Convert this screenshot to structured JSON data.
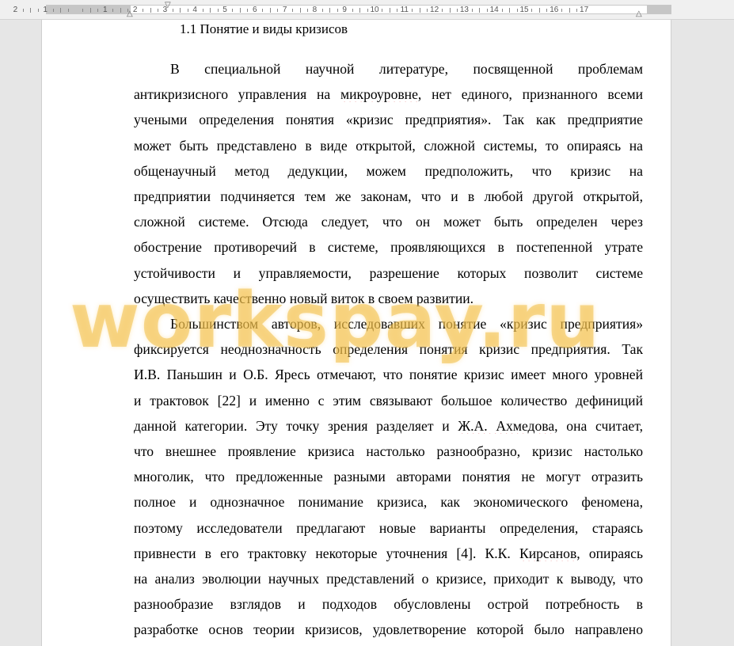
{
  "ruler": {
    "numbers": [
      "2",
      "1",
      "1",
      "2",
      "3",
      "4",
      "5",
      "6",
      "7",
      "8",
      "9",
      "10",
      "11",
      "12",
      "13",
      "14",
      "15",
      "16",
      "17"
    ]
  },
  "document": {
    "heading": "1.1 Понятие и виды кризисов",
    "lines": [
      {
        "text": "В специальной научной литературе, посвященной проблемам",
        "indent": true
      },
      {
        "parts": [
          {
            "t": "антикризисного управления на "
          },
          {
            "t": "микроуровне",
            "spell": true
          },
          {
            "t": ", нет единого, признанного всеми"
          }
        ]
      },
      {
        "text": "учеными определения понятия «кризис предприятия». Так как предприятие"
      },
      {
        "text": "может быть представлено в виде открытой, сложной системы, то опираясь на"
      },
      {
        "text": "общенаучный метод дедукции, можем предположить, что кризис на"
      },
      {
        "text": "предприятии подчиняется тем же законам, что и в любой другой открытой,"
      },
      {
        "text": "сложной системе. Отсюда следует, что он может быть определен через"
      },
      {
        "text": "обострение противоречий в системе, проявляющихся в постепенной утрате"
      },
      {
        "text": "устойчивости и управляемости, разрешение которых позволит системе"
      },
      {
        "text": "осуществить качественно новый виток в своем развитии.",
        "last": true
      },
      {
        "text": "Большинством авторов, исследовавших понятие «кризис предприятия»",
        "indent": true
      },
      {
        "text": "фиксируется неоднозначность определения понятия кризис предприятия. Так"
      },
      {
        "parts": [
          {
            "t": "И.В. Паньшин",
            "spell": true
          },
          {
            "t": " и "
          },
          {
            "t": "О.Б. Яресь",
            "spell": true
          },
          {
            "t": " отмечают, что понятие кризис имеет много уровней"
          }
        ]
      },
      {
        "text": "и трактовок [22] и именно с этим связывают большое количество дефиниций"
      },
      {
        "parts": [
          {
            "t": "данной категории. Эту точку зрения разделяет и "
          },
          {
            "t": "Ж.А. Ахмедова",
            "spell": true
          },
          {
            "t": ", она считает,"
          }
        ]
      },
      {
        "text": "что внешнее проявление кризиса настолько разнообразно, кризис настолько"
      },
      {
        "text": "многолик, что предложенные разными авторами понятия не могут отразить"
      },
      {
        "text": "полное и однозначное понимание кризиса, как экономического феномена,"
      },
      {
        "text": "поэтому исследователи предлагают новые варианты определения, стараясь"
      },
      {
        "parts": [
          {
            "t": "привнести в его трактовку некоторые уточнения [4]. К.К. "
          },
          {
            "t": "Кирсанов",
            "spell": true
          },
          {
            "t": ", опираясь"
          }
        ]
      },
      {
        "text": "на анализ эволюции научных представлений о кризисе, приходит к выводу, что"
      },
      {
        "text": "разнообразие взглядов и подходов обусловлены острой потребность в"
      },
      {
        "text": "разработке основ теории кризисов, удовлетворение которой было направлено"
      }
    ]
  },
  "watermark": "workspay.ru",
  "colors": {
    "watermark": "#f0be46",
    "spellcheck": "#d00000",
    "page": "#ffffff",
    "background": "#e6e6e6"
  }
}
